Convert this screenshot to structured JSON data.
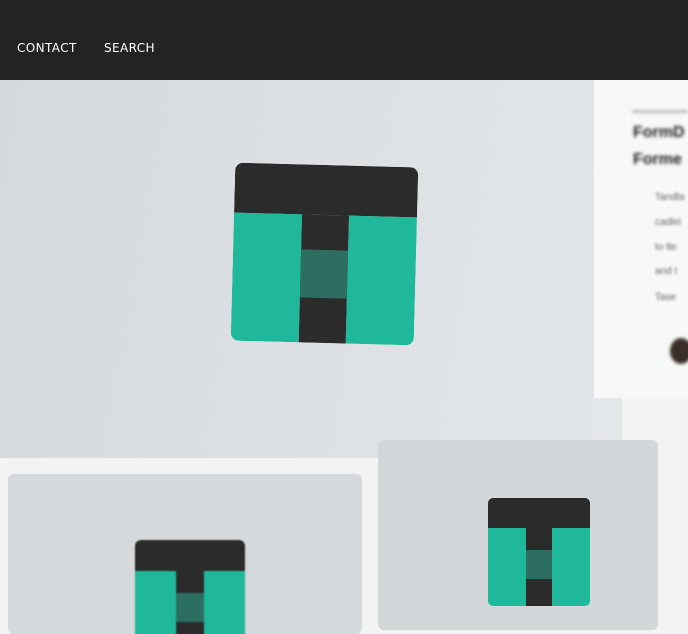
{
  "nav": {
    "contact_label": "CONTACT",
    "search_label": "SEARCH"
  },
  "side_panel": {
    "title_lines": [
      "FormD",
      "Forme"
    ],
    "text_lines": [
      "Tandla",
      "cadlei",
      "to tle",
      "and t",
      "Tase"
    ]
  },
  "colors": {
    "nav_background": "#232323",
    "logo_teal": "#20b89a",
    "logo_dark": "#2b2b2b",
    "logo_band": "#2d6e62"
  },
  "icons": {
    "logo": "t-logo-icon",
    "avatar": "author-avatar"
  }
}
